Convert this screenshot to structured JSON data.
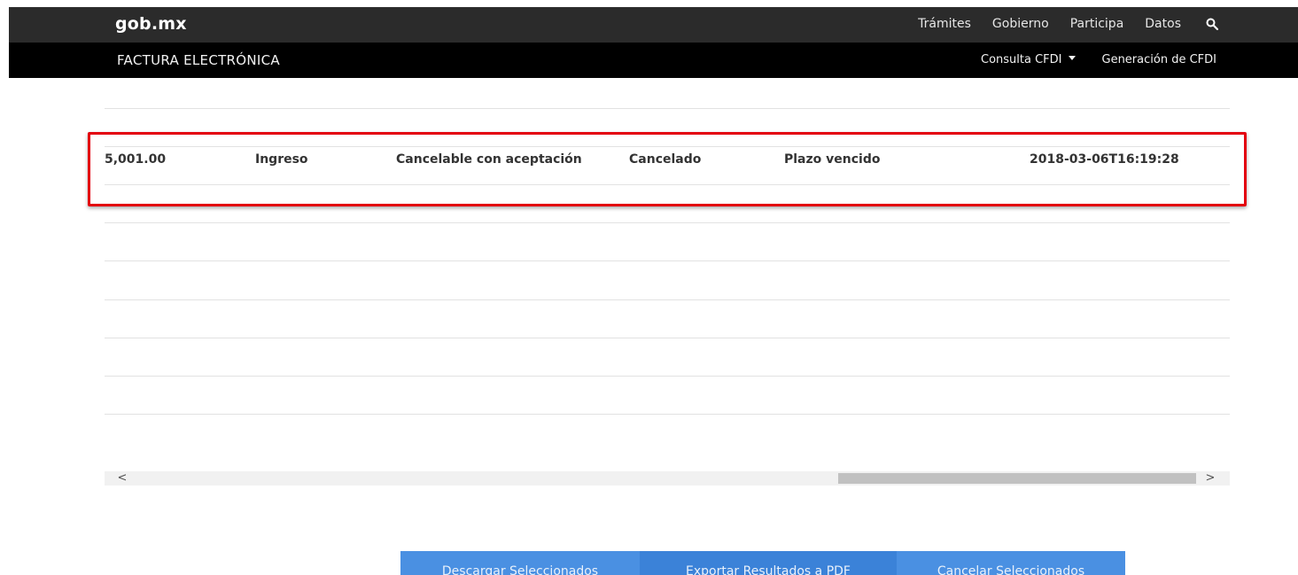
{
  "header": {
    "logo": "gob.mx",
    "nav": [
      "Trámites",
      "Gobierno",
      "Participa",
      "Datos"
    ],
    "search_icon": "search-icon"
  },
  "subheader": {
    "title": "FACTURA ELECTRÓNICA",
    "menu": {
      "consulta": "Consulta CFDI",
      "generacion": "Generación de CFDI"
    }
  },
  "table": {
    "highlighted_row": {
      "total": "5,001.00",
      "efecto": "Ingreso",
      "estatus_cancelacion": "Cancelable con aceptación",
      "estado": "Cancelado",
      "estatus_proceso": "Plazo vencido",
      "fecha": "2018-03-06T16:19:28"
    },
    "highlight_color": "#e3000f"
  },
  "scrollbar": {
    "left_arrow": "<",
    "right_arrow": ">"
  },
  "actions": {
    "download": "Descargar Seleccionados",
    "export": "Exportar Resultados a PDF",
    "cancel": "Cancelar Seleccionados"
  },
  "colors": {
    "topbar": "#2b2b2b",
    "subbar": "#000000",
    "button": "#4a90e2"
  }
}
